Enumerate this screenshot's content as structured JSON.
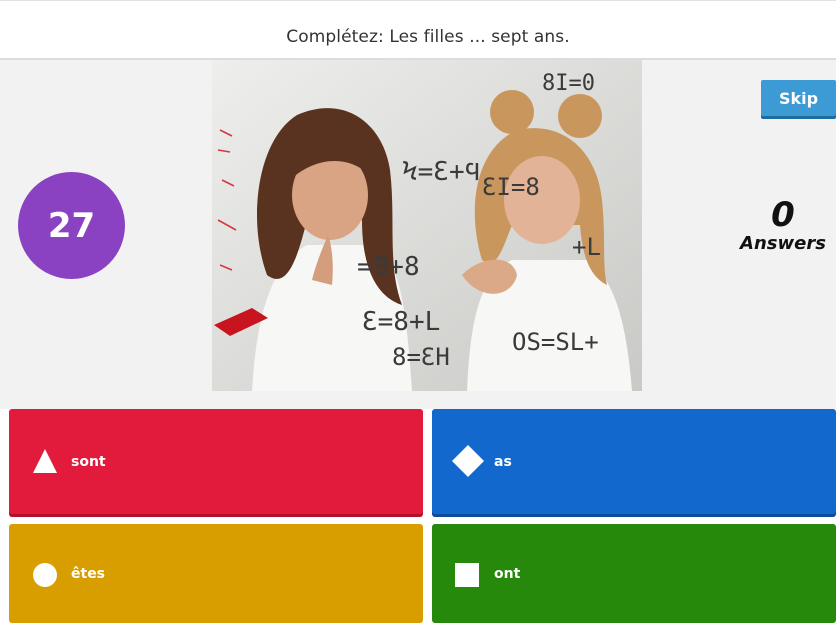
{
  "question": {
    "text": "Complétez: Les filles ... sept ans."
  },
  "timer": {
    "value": "27"
  },
  "skip": {
    "label": "Skip"
  },
  "answers_counter": {
    "count": "0",
    "label": "Answers"
  },
  "options": [
    {
      "label": "sont",
      "shape": "triangle-icon",
      "color": "#e21b3c"
    },
    {
      "label": "as",
      "shape": "diamond-icon",
      "color": "#1368ce"
    },
    {
      "label": "êtes",
      "shape": "circle-icon",
      "color": "#d89e00"
    },
    {
      "label": "ont",
      "shape": "square-icon",
      "color": "#26890c"
    }
  ],
  "colors": {
    "timer": "#8a41c2",
    "skip": "#3c9ad5",
    "stage_bg": "#f2f2f2"
  }
}
